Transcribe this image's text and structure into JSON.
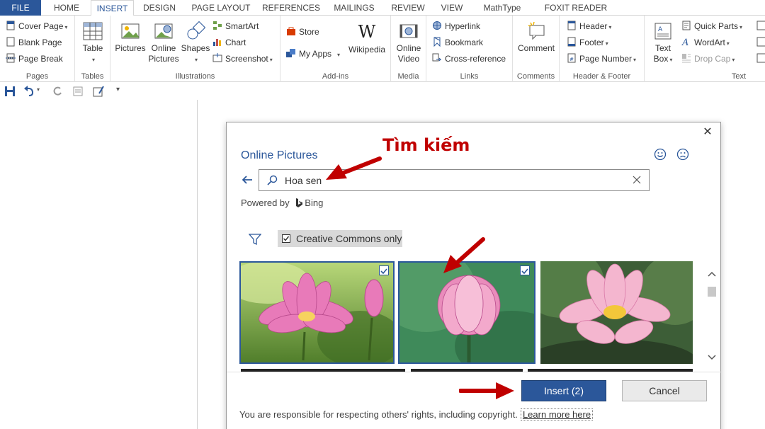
{
  "tabs": [
    {
      "label": "FILE"
    },
    {
      "label": "HOME"
    },
    {
      "label": "INSERT"
    },
    {
      "label": "DESIGN"
    },
    {
      "label": "PAGE LAYOUT"
    },
    {
      "label": "REFERENCES"
    },
    {
      "label": "MAILINGS"
    },
    {
      "label": "REVIEW"
    },
    {
      "label": "VIEW"
    },
    {
      "label": "MathType"
    },
    {
      "label": "FOXIT READER PDF"
    }
  ],
  "ribbon": {
    "pages": {
      "cover_page": "Cover Page",
      "blank_page": "Blank Page",
      "page_break": "Page Break",
      "label": "Pages"
    },
    "tables": {
      "table": "Table",
      "label": "Tables"
    },
    "illustrations": {
      "pictures": "Pictures",
      "online_pictures_1": "Online",
      "online_pictures_2": "Pictures",
      "shapes": "Shapes",
      "smartart": "SmartArt",
      "chart": "Chart",
      "screenshot": "Screenshot",
      "label": "Illustrations"
    },
    "addins": {
      "store": "Store",
      "my_apps": "My Apps",
      "wikipedia": "Wikipedia",
      "label": "Add-ins"
    },
    "media": {
      "online_video_1": "Online",
      "online_video_2": "Video",
      "label": "Media"
    },
    "links": {
      "hyperlink": "Hyperlink",
      "bookmark": "Bookmark",
      "cross_reference": "Cross-reference",
      "label": "Links"
    },
    "comments": {
      "comment": "Comment",
      "label": "Comments"
    },
    "header_footer": {
      "header": "Header",
      "footer": "Footer",
      "page_number": "Page Number",
      "label": "Header & Footer"
    },
    "text": {
      "text_box_1": "Text",
      "text_box_2": "Box",
      "quick_parts": "Quick Parts",
      "wordart": "WordArt",
      "drop_cap": "Drop Cap",
      "label": "Text"
    }
  },
  "dialog": {
    "title": "Online Pictures",
    "search_value": "Hoa sen",
    "powered_by": "Powered by",
    "bing": "Bing",
    "creative_commons": "Creative Commons only",
    "annotation": "Tìm kiếm",
    "insert_button": "Insert (2)",
    "cancel_button": "Cancel",
    "rights_text": "You are responsible for respecting others' rights, including copyright.",
    "learn_more": "Learn more here"
  },
  "colors": {
    "accent": "#2b579a",
    "annotation": "#c00000"
  }
}
